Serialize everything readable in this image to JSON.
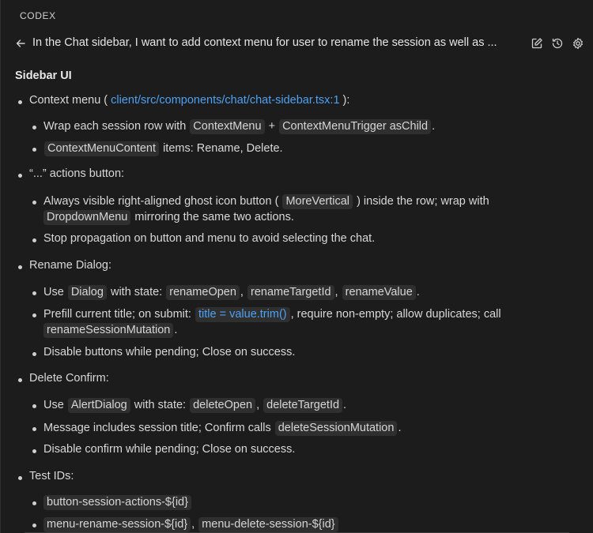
{
  "panel": {
    "title": "CODEX"
  },
  "header": {
    "thread_title": "In the Chat sidebar, I want to add context menu for user to rename the session as well as ..."
  },
  "content": {
    "heading": "Sidebar UI",
    "s1": {
      "label_pre": "Context menu (",
      "link": "client/src/components/chat/chat-sidebar.tsx:1",
      "label_post": "):",
      "i1": {
        "pre": "Wrap each session row with",
        "c1": "ContextMenu",
        "mid": "+",
        "c2": "ContextMenuTrigger asChild",
        "post": "."
      },
      "i2": {
        "c1": "ContextMenuContent",
        "post": "items: Rename, Delete."
      }
    },
    "s2": {
      "label": "“...” actions button:",
      "i1": {
        "pre": "Always visible right-aligned ghost icon button (",
        "c1": "MoreVertical",
        "post": ") inside the row; wrap with",
        "c2": "DropdownMenu",
        "post2": "mirroring the same two actions."
      },
      "i2": {
        "text": "Stop propagation on button and menu to avoid selecting the chat."
      }
    },
    "s3": {
      "label": "Rename Dialog:",
      "i1": {
        "pre": "Use",
        "c1": "Dialog",
        "mid": "with state:",
        "c2": "renameOpen",
        "sep1": ",",
        "c3": "renameTargetId",
        "sep2": ",",
        "c4": "renameValue",
        "post": "."
      },
      "i2": {
        "pre": "Prefill current title; on submit:",
        "c1": "title = value.trim()",
        "post": ", require non-empty; allow duplicates; call",
        "c2": "renameSessionMutation",
        "post2": "."
      },
      "i3": {
        "text": "Disable buttons while pending; Close on success."
      }
    },
    "s4": {
      "label": "Delete Confirm:",
      "i1": {
        "pre": "Use",
        "c1": "AlertDialog",
        "mid": "with state:",
        "c2": "deleteOpen",
        "sep": ",",
        "c3": "deleteTargetId",
        "post": "."
      },
      "i2": {
        "pre": "Message includes session title; Confirm calls",
        "c1": "deleteSessionMutation",
        "post": "."
      },
      "i3": {
        "text": "Disable confirm while pending; Close on success."
      }
    },
    "s5": {
      "label": "Test IDs:",
      "i1": {
        "c1": "button-session-actions-${id}"
      },
      "i2": {
        "c1": "menu-rename-session-${id}",
        "sep": ",",
        "c2": "menu-delete-session-${id}"
      }
    }
  },
  "icons": {
    "back": "arrow-left-icon",
    "edit": "edit-icon",
    "history": "history-icon",
    "settings": "gear-icon"
  },
  "colors": {
    "background": "#1c1c1c",
    "code_background": "#2f2f2f",
    "link": "#4ea1f3"
  }
}
